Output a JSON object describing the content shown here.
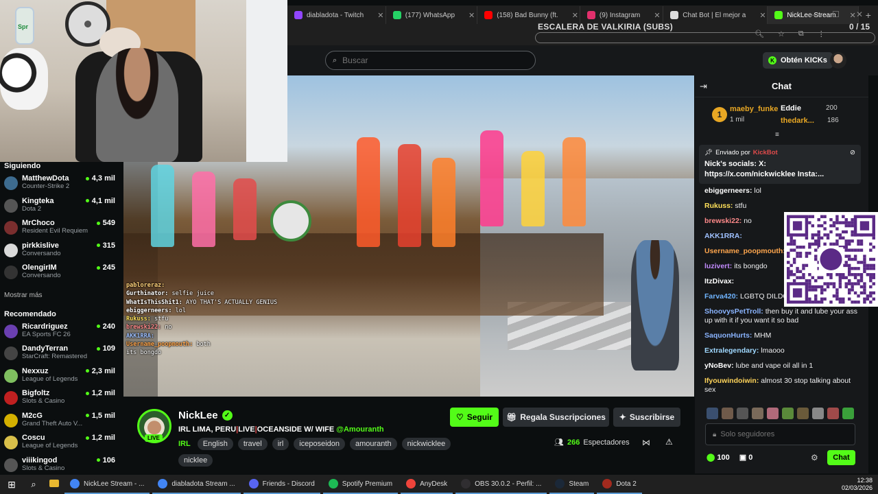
{
  "overlay": {
    "title": "ESCALERA DE VALKIRIA (SUBS)",
    "count": "0 / 15"
  },
  "browser": {
    "tabs": [
      {
        "label": "diabladota - Twitch",
        "color": "#9146ff"
      },
      {
        "label": "(177) WhatsApp",
        "color": "#25d366"
      },
      {
        "label": "(158) Bad Bunny (ft.",
        "color": "#ff0000"
      },
      {
        "label": "(9) Instagram",
        "color": "#e1306c"
      },
      {
        "label": "Chat Bot | El mejor a",
        "color": "#dddddd"
      },
      {
        "label": "NickLee Stream",
        "color": "#53fc18"
      }
    ],
    "new_tab": "+"
  },
  "header": {
    "search_placeholder": "Buscar",
    "kicks_button": "Obtén KICKs"
  },
  "sidebar": {
    "following_title": "Siguiendo",
    "following": [
      {
        "name": "MatthewDota",
        "category": "Counter-Strike 2",
        "viewers": "4,3 mil",
        "color": "#3d6b8f"
      },
      {
        "name": "Kingteka",
        "category": "Dota 2",
        "viewers": "4,1 mil",
        "color": "#555"
      },
      {
        "name": "MrChoco",
        "category": "Resident Evil Requiem",
        "viewers": "549",
        "color": "#7a2e2e"
      },
      {
        "name": "pirkkislive",
        "category": "Conversando",
        "viewers": "315",
        "color": "#d9d9d9"
      },
      {
        "name": "OlengirIM",
        "category": "Conversando",
        "viewers": "245",
        "color": "#333"
      }
    ],
    "show_more": "Mostrar más",
    "recommended_title": "Recomendado",
    "recommended": [
      {
        "name": "Ricardriguez",
        "category": "EA Sports FC 26",
        "viewers": "240",
        "color": "#6a3fb0"
      },
      {
        "name": "DandyTerran",
        "category": "StarCraft: Remastered",
        "viewers": "109",
        "color": "#444"
      },
      {
        "name": "Nexxuz",
        "category": "League of Legends",
        "viewers": "2,3 mil",
        "color": "#7fbf5f"
      },
      {
        "name": "Bigfoltz",
        "category": "Slots & Casino",
        "viewers": "1,2 mil",
        "color": "#c02020"
      },
      {
        "name": "M2cG",
        "category": "Grand Theft Auto V...",
        "viewers": "1,5 mil",
        "color": "#d4b000"
      },
      {
        "name": "Coscu",
        "category": "League of Legends",
        "viewers": "1,2 mil",
        "color": "#d9c04a"
      },
      {
        "name": "viiikingod",
        "category": "Slots & Casino",
        "viewers": "106",
        "color": "#555"
      }
    ]
  },
  "video_chat": [
    {
      "user": "pabloreraz:",
      "text": "",
      "color": "#ffd27a"
    },
    {
      "user": "Gurthinator:",
      "text": "selfie juice",
      "color": "#ffffff"
    },
    {
      "user": "WhatIsThisShit1:",
      "text": "AYO THAT'S ACTUALLY GENIUS",
      "color": "#ffffff"
    },
    {
      "user": "ebiggerneers:",
      "text": "lol",
      "color": "#ffffff"
    },
    {
      "user": "Rukuss:",
      "text": "stfu",
      "color": "#ffe15a"
    },
    {
      "user": "brewski22:",
      "text": "no",
      "color": "#ff8a8a"
    },
    {
      "user": "AKK1RRA:",
      "text": "",
      "color": "#9fc1ff"
    },
    {
      "user": "Username_poopmouth:",
      "text": "both",
      "color": "#ffa64d"
    },
    {
      "user": "",
      "text": "its bongdo",
      "color": "#c38bff"
    }
  ],
  "stream": {
    "channel": "NickLee",
    "live": "LIVE",
    "title_parts": [
      "IRL LIMA, PERU",
      "LIVE",
      "OCEANSIDE W/ WIFE"
    ],
    "mention": "@Amouranth",
    "category": "IRL",
    "tags": [
      "English",
      "travel",
      "irl",
      "iceposeidon",
      "amouranth",
      "nickwicklee",
      "nicklee"
    ],
    "follow": "Seguir",
    "gift": "Regala Suscripciones",
    "subscribe": "Suscribirse",
    "viewers": "266",
    "viewers_label": "Espectadores"
  },
  "chat": {
    "title": "Chat",
    "leaderboard": {
      "first_name": "maeby_funke",
      "first_value": "1 mil",
      "second_name": "Eddie",
      "second_value": "200",
      "third_name": "thedark...",
      "third_value": "186"
    },
    "pinned": {
      "sent_by": "Enviado por",
      "bot": "KickBot",
      "message": "Nick's socials: X: https://x.com/nickwicklee Insta:..."
    },
    "messages": [
      {
        "user": "ebiggerneers:",
        "text": "lol",
        "color": "#ffffff"
      },
      {
        "user": "Rukuss:",
        "text": "stfu",
        "color": "#ffe15a"
      },
      {
        "user": "brewski22:",
        "text": "no",
        "color": "#ff8a8a"
      },
      {
        "user": "AKK1RRA:",
        "text": "",
        "color": "#9fc1ff"
      },
      {
        "user": "Username_poopmouth:",
        "text": "b",
        "color": "#ffa64d"
      },
      {
        "user": "luzivert:",
        "text": "its bongdo",
        "color": "#c38bff"
      },
      {
        "user": "ItzDivax:",
        "text": "",
        "color": "#ffffff"
      },
      {
        "user": "Farva420:",
        "text": "LGBTQ DILDO",
        "color": "#6fb4ff"
      },
      {
        "user": "ShoovysPetTroll:",
        "text": "then buy it and lube your ass up with it if you want it so bad",
        "color": "#8ab4ff"
      },
      {
        "user": "SaquonHurts:",
        "text": "MHM",
        "color": "#8ab4ff"
      },
      {
        "user": "Extralegendary:",
        "text": "lmaooo",
        "color": "#9fd8ff"
      },
      {
        "user": "yNoBev:",
        "text": "lube and vape oil all in 1",
        "color": "#ffffff"
      },
      {
        "user": "Ifyouwindoiwin:",
        "text": "almost 30 stop talking about sex",
        "color": "#ffd45a"
      }
    ],
    "input_placeholder": "Solo seguidores",
    "points": "100",
    "gifts": "0",
    "send": "Chat"
  },
  "taskbar": {
    "apps": [
      {
        "label": "NickLee Stream - ...",
        "color": "#4285f4"
      },
      {
        "label": "diabladota Stream ...",
        "color": "#4285f4"
      },
      {
        "label": "Friends - Discord",
        "color": "#5865f2"
      },
      {
        "label": "Spotify Premium",
        "color": "#1db954"
      },
      {
        "label": "AnyDesk",
        "color": "#ef443b"
      },
      {
        "label": "OBS 30.0.2 - Perfil: ...",
        "color": "#302e31"
      },
      {
        "label": "Steam",
        "color": "#1b2838"
      },
      {
        "label": "Dota 2",
        "color": "#a32a1e"
      }
    ],
    "time": "12:38",
    "date": "02/03/2026"
  },
  "colors": {
    "kick_green": "#53fc18",
    "background": "#0b0e0f",
    "panel": "#16181a"
  }
}
